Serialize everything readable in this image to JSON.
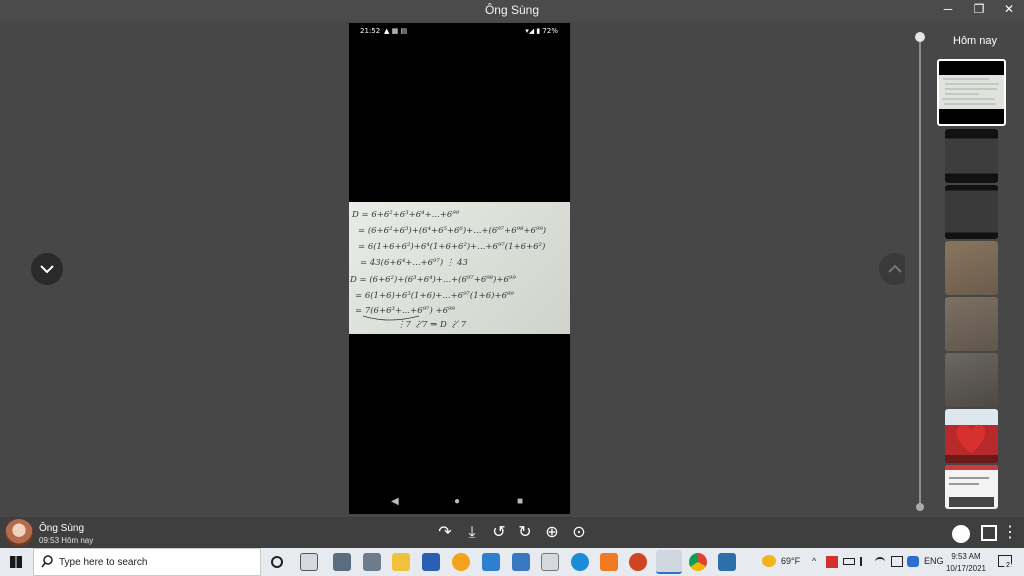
{
  "window": {
    "title": "Ông Sùng",
    "minimize": "─",
    "maximize": "❐",
    "close": "✕"
  },
  "phone": {
    "status_time": "21:52",
    "status_left_icons": "▲ ▦ ▤",
    "status_right": "▾◢ ▮ 72%",
    "nav": {
      "back": "◀",
      "home": "●",
      "recent": "■"
    }
  },
  "handwriting": [
    "D = 6+6²+6³+6⁴+...+6⁹⁹",
    "= (6+6²+6³)+(6⁴+6⁵+6⁶)+...+(6⁹⁷+6⁹⁸+6⁹⁹)",
    "= 6(1+6+6²)+6⁴(1+6+6²)+...+6⁹⁷(1+6+6²)",
    "= 43(6+6⁴+...+6⁹⁷) ⋮ 43",
    "D = (6+6²)+(6³+6⁴)+...+(6⁹⁷+6⁹⁸)+6⁹⁹",
    "= 6(1+6)+6³(1+6)+...+6⁹⁷(1+6)+6⁹⁹",
    "= 7(6+6³+...+6⁹⁷) +6⁹⁹",
    "⋮7          ⋮̸7       ⇒ D ⋮̸ 7"
  ],
  "sidebar": {
    "today_label": "Hôm nay"
  },
  "thumbnails": [
    {
      "kind": "math-photo",
      "color": "#dfe3dc",
      "active": true
    },
    {
      "kind": "dark-notes",
      "color": "#3d3d3d"
    },
    {
      "kind": "dark-notes",
      "color": "#3a3a3a"
    },
    {
      "kind": "paper-notes",
      "color": "#7a6a58"
    },
    {
      "kind": "paper-notes",
      "color": "#6f655a"
    },
    {
      "kind": "paper-notes",
      "color": "#5e5a55"
    },
    {
      "kind": "heart-photo",
      "color": "#b8292b"
    },
    {
      "kind": "screenshot",
      "color": "#f3f3f3"
    }
  ],
  "sender": {
    "name": "Ông Sùng",
    "time": "09:53 Hôm nay"
  },
  "toolbar": {
    "share": "↷",
    "download": "⤓",
    "rotate_left": "↺",
    "rotate_right": "↻",
    "zoom_in": "⊕",
    "zoom_fit": "⊙",
    "more": "⋮"
  },
  "taskbar": {
    "search_placeholder": "Type here to search",
    "weather": "69°F",
    "language": "ENG",
    "time": "9:53 AM",
    "date": "10/17/2021",
    "notifications": "2"
  }
}
